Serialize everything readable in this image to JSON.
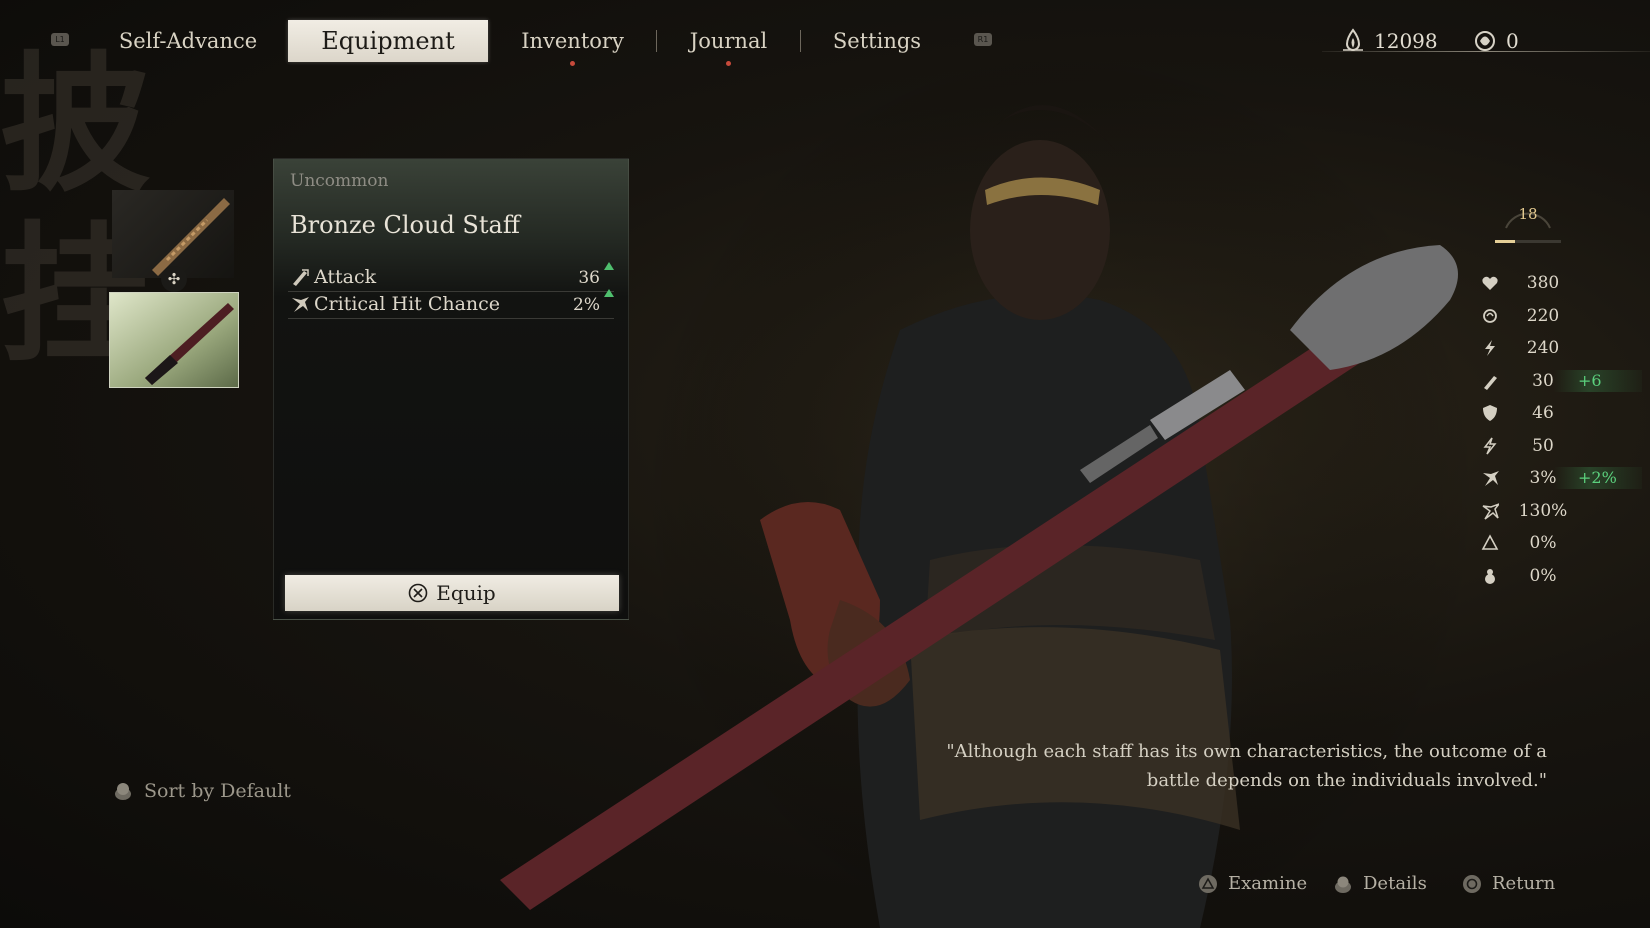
{
  "nav": {
    "left_hint": "L1",
    "right_hint": "R1",
    "tabs": [
      {
        "label": "Self-Advance",
        "active": false
      },
      {
        "label": "Equipment",
        "active": true
      },
      {
        "label": "Inventory",
        "active": false,
        "notify": true
      },
      {
        "label": "Journal",
        "active": false,
        "notify": true
      },
      {
        "label": "Settings",
        "active": false
      }
    ]
  },
  "currency": {
    "will": "12098",
    "sparks": "0"
  },
  "items": [
    {
      "name": "Bronze Cloud Staff thumbnail",
      "selected": false,
      "icon": "staff-icon"
    },
    {
      "name": "Selected staff thumbnail",
      "selected": true,
      "icon": "staff-icon"
    }
  ],
  "item_badge_icon": "equipped-emblem-icon",
  "detail": {
    "rarity": "Uncommon",
    "name": "Bronze Cloud Staff",
    "stats": [
      {
        "icon": "attack-icon",
        "label": "Attack",
        "value": "36",
        "increase": true
      },
      {
        "icon": "crit-icon",
        "label": "Critical Hit Chance",
        "value": "2%",
        "increase": true
      }
    ],
    "equip_label": "Equip",
    "equip_button_glyph": "cross-button-icon"
  },
  "character": {
    "level": "18",
    "level_progress": 0.3,
    "stats": [
      {
        "icon": "health-icon",
        "value": "380",
        "bonus": ""
      },
      {
        "icon": "mana-icon",
        "value": "220",
        "bonus": ""
      },
      {
        "icon": "stamina-icon",
        "value": "240",
        "bonus": ""
      },
      {
        "icon": "attack-icon",
        "value": "30",
        "bonus": "+6"
      },
      {
        "icon": "defense-icon",
        "value": "46",
        "bonus": ""
      },
      {
        "icon": "stamina-recovery-icon",
        "value": "50",
        "bonus": ""
      },
      {
        "icon": "crit-icon",
        "value": "3%",
        "bonus": "+2%"
      },
      {
        "icon": "crit-damage-icon",
        "value": "130%",
        "bonus": ""
      },
      {
        "icon": "resist-icon",
        "value": "0%",
        "bonus": ""
      },
      {
        "icon": "gourd-icon",
        "value": "0%",
        "bonus": ""
      }
    ]
  },
  "quote": "\"Although each staff has its own characteristics, the outcome of a battle depends on the individuals involved.\"",
  "footer": {
    "sort_label": "Sort by Default",
    "examine_label": "Examine",
    "details_label": "Details",
    "return_label": "Return"
  },
  "colors": {
    "bonus_green": "#5bd07d",
    "notify_red": "#c74a3b",
    "level_gold": "#e3c98f"
  }
}
